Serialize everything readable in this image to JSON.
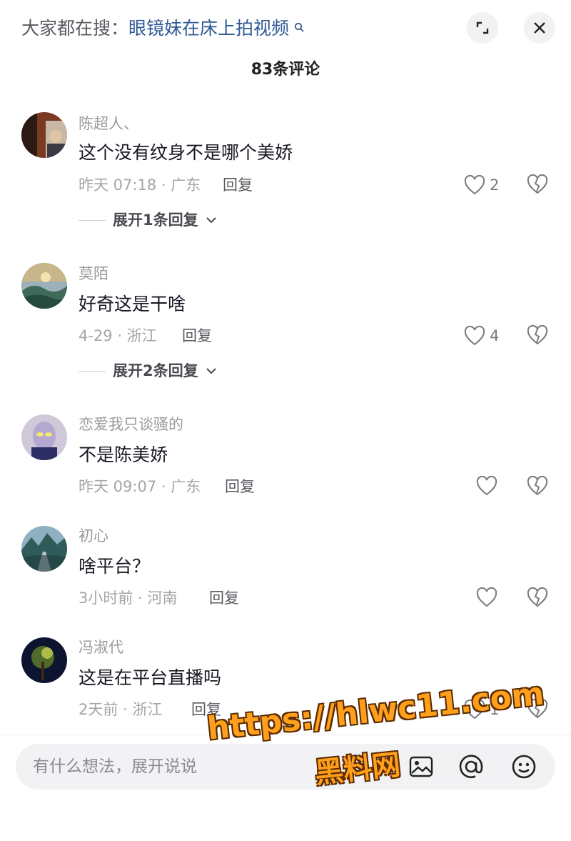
{
  "header": {
    "search_prefix": "大家都在搜：",
    "search_term": "眼镜妹在床上拍视频",
    "comment_count": "83条评论"
  },
  "comments": [
    {
      "user": "陈超人、",
      "text": "这个没有纹身不是哪个美娇",
      "meta": "昨天 07:18 · 广东",
      "reply": "回复",
      "likes": "2",
      "expand": "展开1条回复"
    },
    {
      "user": "莫陌",
      "text": "好奇这是干啥",
      "meta": "4-29 · 浙江",
      "reply": "回复",
      "likes": "4",
      "expand": "展开2条回复"
    },
    {
      "user": "恋爱我只谈骚的",
      "text": "不是陈美娇",
      "meta": "昨天 09:07 · 广东",
      "reply": "回复",
      "likes": ""
    },
    {
      "user": "初心",
      "text": "啥平台？",
      "meta": "3小时前 · 河南",
      "reply": "回复",
      "likes": ""
    },
    {
      "user": "冯淑代",
      "text": "这是在平台直播吗",
      "meta": "2天前 · 浙江",
      "reply": "回复",
      "likes": "1"
    }
  ],
  "input": {
    "placeholder": "有什么想法，展开说说"
  },
  "watermark": {
    "line1": "https://hlwc11.com",
    "line2": "黑料网"
  },
  "colors": {
    "link": "#2f5a94",
    "watermark": "#ff9f1c"
  }
}
